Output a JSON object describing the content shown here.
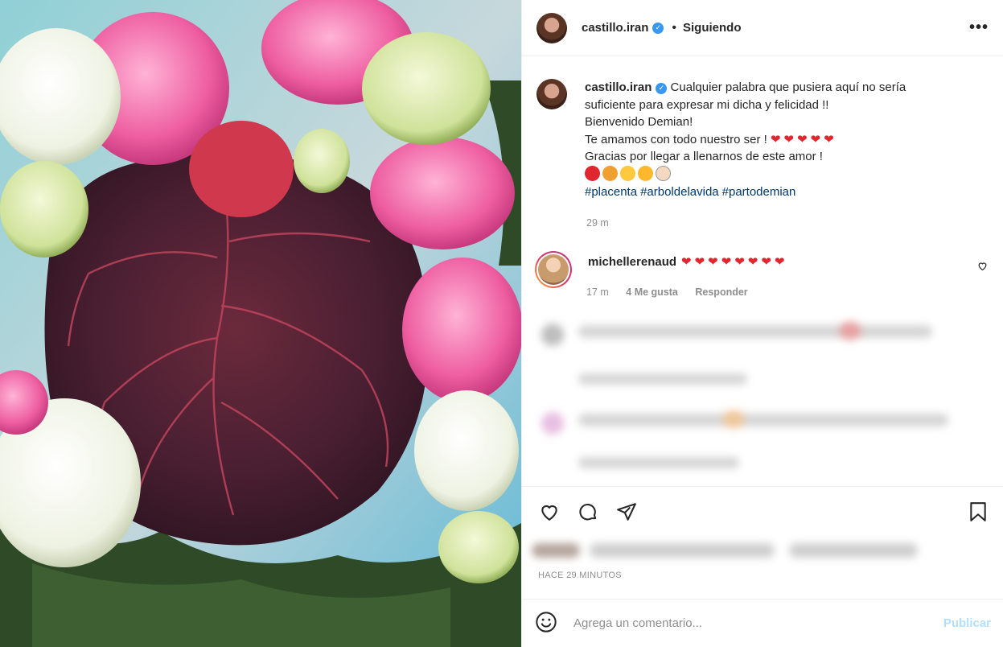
{
  "post": {
    "username": "castillo.iran",
    "follow_status": "Siguiendo",
    "more_label": "•••",
    "caption_lines": [
      "Cualquier palabra que pusiera aquí no sería",
      "suficiente para expresar mi dicha y felicidad !!",
      "Bienvenido Demian!",
      "Te amamos con todo nuestro ser !",
      "Gracias por llegar a llenarnos de este amor !"
    ],
    "caption_hearts": "❤❤❤❤❤",
    "hashtags": [
      "#placenta",
      "#arboldelavida",
      "#partodemian"
    ],
    "caption_time": "29 m"
  },
  "comment": {
    "username": "michellerenaud",
    "hearts": "❤❤❤❤❤❤❤❤",
    "time": "17 m",
    "likes": "4 Me gusta",
    "reply": "Responder"
  },
  "footer": {
    "ago": "HACE 29 MINUTOS",
    "placeholder": "Agrega un comentario...",
    "publish": "Publicar"
  },
  "colors": {
    "verified": "#3897f0",
    "heart": "#e0262f",
    "link": "#00376b",
    "publish_disabled": "#b2dffc"
  },
  "icons": [
    "verified-icon",
    "heart-icon",
    "comment-icon",
    "share-icon",
    "bookmark-icon",
    "emoji-icon",
    "more-options-icon"
  ]
}
